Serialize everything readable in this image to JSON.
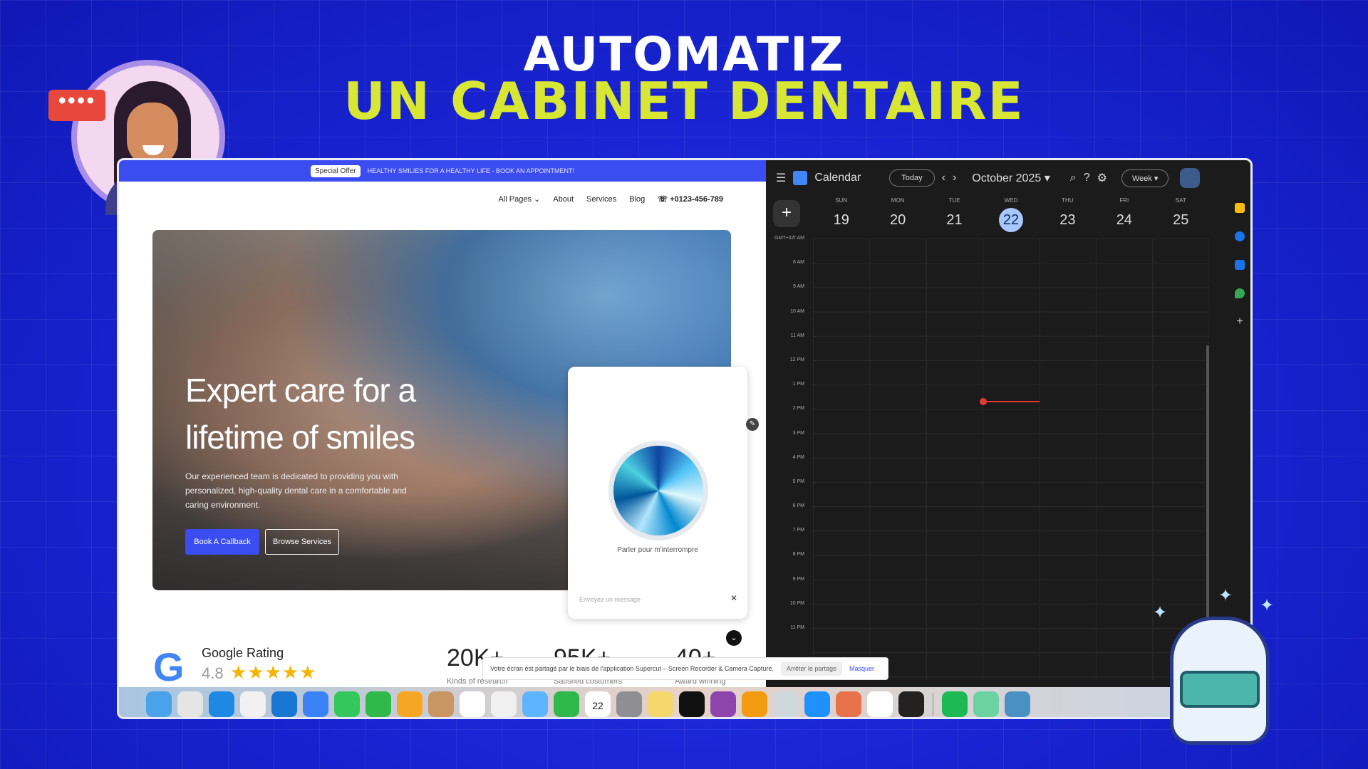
{
  "headline": {
    "line1": "AUTOMATIZ",
    "line2": "UN CABINET DENTAIRE"
  },
  "avatar": {
    "bubble": "••••"
  },
  "site": {
    "promo_badge": "Special Offer",
    "promo_text": "HEALTHY SMILIES FOR A HEALTHY LIFE - BOOK AN APPOINTMENT!",
    "nav": {
      "all_pages": "All Pages ⌄",
      "about": "About",
      "services": "Services",
      "blog": "Blog",
      "phone": "+0123-456-789"
    },
    "hero_title": "Expert care for a lifetime of smiles",
    "hero_desc": "Our experienced team is dedicated to providing you with personalized, high-quality dental care in a comfortable and caring environment.",
    "btn_primary": "Book A Callback",
    "btn_secondary": "Browse Services",
    "google_rating_label": "Google Rating",
    "google_score": "4.8",
    "stars": "★★★★★",
    "stats": [
      {
        "value": "20K+",
        "label": "Kinds of research"
      },
      {
        "value": "95K+",
        "label": "Satisfied customers"
      },
      {
        "value": "40+",
        "label": "Award winning"
      }
    ]
  },
  "chat": {
    "orb_label": "Parler pour m'interrompre",
    "input_placeholder": "Envoyez un message",
    "send_icon": "✕"
  },
  "share_bar": {
    "text": "Votre écran est partagé par le biais de l'application Supercut – Screen Recorder & Camera Capture.",
    "stop": "Arrêter le partage",
    "hide": "Masquer"
  },
  "calendar": {
    "app_name": "Calendar",
    "today_btn": "Today",
    "month": "October 2025 ▾",
    "view": "Week ▾",
    "timezone": "GMT+02",
    "days": [
      {
        "name": "SUN",
        "num": "19"
      },
      {
        "name": "MON",
        "num": "20"
      },
      {
        "name": "TUE",
        "num": "21"
      },
      {
        "name": "WED",
        "num": "22",
        "today": true
      },
      {
        "name": "THU",
        "num": "23"
      },
      {
        "name": "FRI",
        "num": "24"
      },
      {
        "name": "SAT",
        "num": "25"
      }
    ],
    "hours": [
      "7 AM",
      "8 AM",
      "9 AM",
      "10 AM",
      "11 AM",
      "12 PM",
      "1 PM",
      "2 PM",
      "3 PM",
      "4 PM",
      "5 PM",
      "6 PM",
      "7 PM",
      "8 PM",
      "9 PM",
      "10 PM",
      "11 PM"
    ]
  },
  "dock": {
    "date_label": "22",
    "apps": [
      "finder",
      "launchpad",
      "safari",
      "chrome",
      "vscode",
      "mail",
      "messages",
      "facetime",
      "photos",
      "contacts",
      "reminders",
      "freeform",
      "maps",
      "numbers",
      "calendar",
      "settings",
      "notes",
      "appletv",
      "podcasts",
      "pages",
      "preview",
      "appstore",
      "claude",
      "notion",
      "dataviz",
      "spotify",
      "grapher",
      "quicktime"
    ],
    "colors": [
      "#4aa3e8",
      "#e5e5e5",
      "#1e88e5",
      "#f1f1f1",
      "#1976d2",
      "#3b82f6",
      "#34c759",
      "#2fb94a",
      "#f5a623",
      "#c89563",
      "#ffffff",
      "#f0f0f0",
      "#5eb4ff",
      "#2fb94a",
      "#ffffff",
      "#8e8e93",
      "#f5d76e",
      "#111111",
      "#8e44ad",
      "#f39c12",
      "#cfd8dc",
      "#1e90ff",
      "#e8734a",
      "#ffffff",
      "#222222",
      "#1db954",
      "#6bd3a0",
      "#4a90c2"
    ]
  }
}
